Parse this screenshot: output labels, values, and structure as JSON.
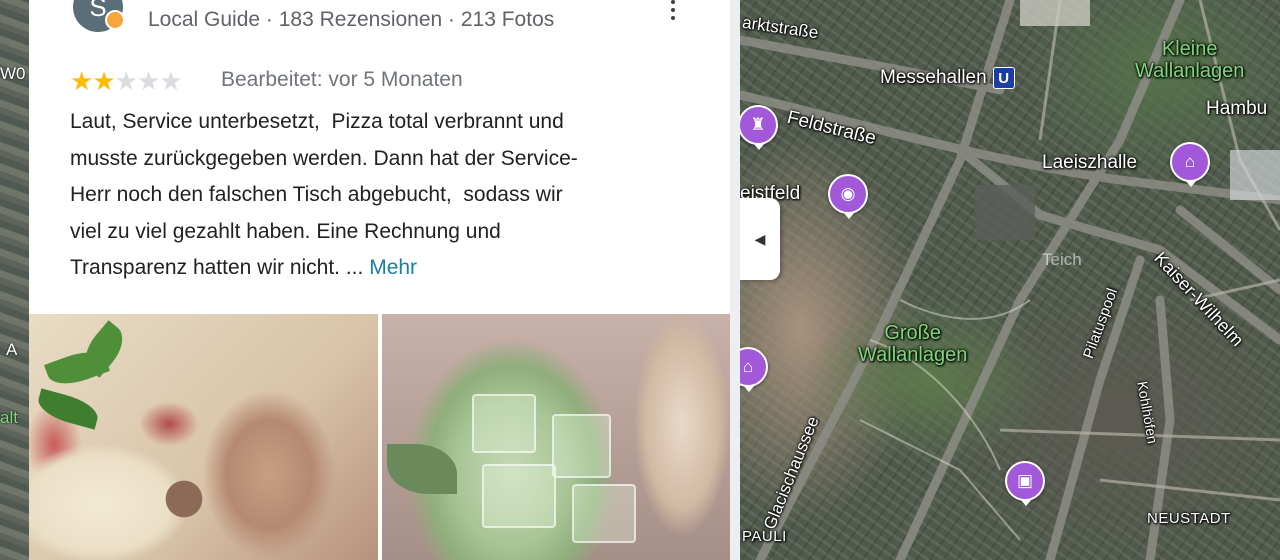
{
  "review": {
    "avatar_letter": "S",
    "reviewer_meta": "Local Guide · 183 Rezensionen · 213 Fotos",
    "rating": 2,
    "rating_max": 5,
    "edited": "Bearbeitet: vor 5 Monaten",
    "text_lines": [
      "Laut, Service unterbesetzt,  Pizza total verbrannt und",
      "musste zurückgegeben werden. Dann hat der Service-",
      "Herr noch den falschen Tisch abgebucht,  sodass wir",
      "viel zu viel gezahlt haben. Eine Rechnung und",
      "Transparenz hatten wir nicht. ... "
    ],
    "more_label": "Mehr",
    "photos": [
      "pizza-photo",
      "drink-photo"
    ]
  },
  "left_edge_labels": [
    "W0",
    "A",
    "alt"
  ],
  "map": {
    "labels": {
      "marktstrasse": "arktstraße",
      "messehallen": "Messehallen",
      "subway": "U",
      "kleine_wallanlagen": "Kleine\nWallanlagen",
      "hamburg": "Hambu",
      "feldstrasse": "Feldstraße",
      "laeiszhalle": "Laeiszhalle",
      "heiligengeistfeld": "eistfeld",
      "teich": "Teich",
      "kaiser_wilhelm": "Kaiser-Wilhelm",
      "pilatuspool": "Pilatuspool",
      "grosse_wallanlagen": "Große\nWallanlagen",
      "glacischaussee": "Glacischaussee",
      "kohlhoefen": "Kohlhöfen",
      "neustadt": "NEUSTADT",
      "pauli": "PAULI"
    }
  },
  "colors": {
    "star_on": "#fbbc04",
    "star_off": "#dadce0",
    "link": "#1a7fa0",
    "poi": "#a259d9",
    "park_label": "#7dd87a"
  }
}
